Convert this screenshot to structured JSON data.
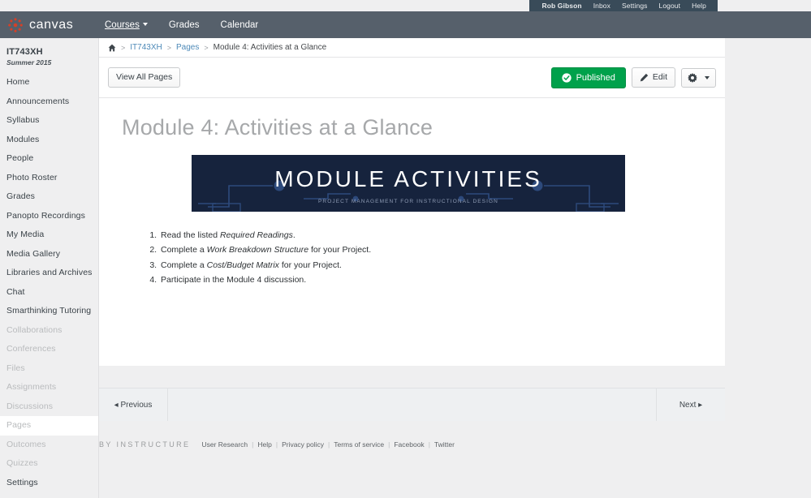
{
  "utility_bar": {
    "items": [
      {
        "label": "Rob Gibson",
        "name": "user-name"
      },
      {
        "label": "Inbox",
        "name": "inbox"
      },
      {
        "label": "Settings",
        "name": "settings"
      },
      {
        "label": "Logout",
        "name": "logout"
      },
      {
        "label": "Help",
        "name": "help"
      }
    ]
  },
  "nav": {
    "brand": "canvas",
    "brand_color": "#d64027",
    "links": [
      {
        "label": "Courses",
        "active": true,
        "has_caret": true
      },
      {
        "label": "Grades",
        "active": false,
        "has_caret": false
      },
      {
        "label": "Calendar",
        "active": false,
        "has_caret": false
      }
    ]
  },
  "sidebar": {
    "course_code": "IT743XH",
    "course_term": "Summer 2015",
    "items": [
      {
        "label": "Home",
        "state": "normal"
      },
      {
        "label": "Announcements",
        "state": "normal"
      },
      {
        "label": "Syllabus",
        "state": "normal"
      },
      {
        "label": "Modules",
        "state": "normal"
      },
      {
        "label": "People",
        "state": "normal"
      },
      {
        "label": "Photo Roster",
        "state": "normal"
      },
      {
        "label": "Grades",
        "state": "normal"
      },
      {
        "label": "Panopto Recordings",
        "state": "normal"
      },
      {
        "label": "My Media",
        "state": "normal"
      },
      {
        "label": "Media Gallery",
        "state": "normal"
      },
      {
        "label": "Libraries and Archives",
        "state": "normal"
      },
      {
        "label": "Chat",
        "state": "normal"
      },
      {
        "label": "Smarthinking Tutoring",
        "state": "normal"
      },
      {
        "label": "Collaborations",
        "state": "dim"
      },
      {
        "label": "Conferences",
        "state": "dim"
      },
      {
        "label": "Files",
        "state": "dim"
      },
      {
        "label": "Assignments",
        "state": "dim"
      },
      {
        "label": "Discussions",
        "state": "dim"
      },
      {
        "label": "Pages",
        "state": "active"
      },
      {
        "label": "Outcomes",
        "state": "dim"
      },
      {
        "label": "Quizzes",
        "state": "dim"
      },
      {
        "label": "Settings",
        "state": "normal"
      }
    ]
  },
  "breadcrumb": {
    "home_icon": "home-icon",
    "separator": ">",
    "items": [
      {
        "label": "IT743XH",
        "link": true
      },
      {
        "label": "Pages",
        "link": true
      },
      {
        "label": "Module 4: Activities at a Glance",
        "link": false
      }
    ]
  },
  "toolbar": {
    "view_all_pages_label": "View All Pages",
    "published_label": "Published",
    "published_color": "#00a14b",
    "edit_label": "Edit",
    "gear_icon": "gear-icon"
  },
  "page": {
    "title": "Module 4: Activities at a Glance",
    "banner": {
      "title": "MODULE  ACTIVITIES",
      "subtitle": "PROJECT MANAGEMENT FOR INSTRUCTIONAL DESIGN",
      "background_color": "#16233d",
      "line_color": "#2d4a7c"
    },
    "activities": [
      {
        "pre": "Read the listed ",
        "em": "Required Readings",
        "post": "."
      },
      {
        "pre": "Complete a ",
        "em": "Work Breakdown Structure",
        "post": " for your Project."
      },
      {
        "pre": "Complete a ",
        "em": "Cost/Budget Matrix",
        "post": " for your Project."
      },
      {
        "pre": "Participate in the Module 4 discussion.",
        "em": "",
        "post": ""
      }
    ]
  },
  "pager": {
    "previous_label": "Previous",
    "next_label": "Next"
  },
  "footer": {
    "by_instructure": "BY INSTRUCTURE",
    "links": [
      "User Research",
      "Help",
      "Privacy policy",
      "Terms of service",
      "Facebook",
      "Twitter"
    ],
    "separator": "|"
  }
}
